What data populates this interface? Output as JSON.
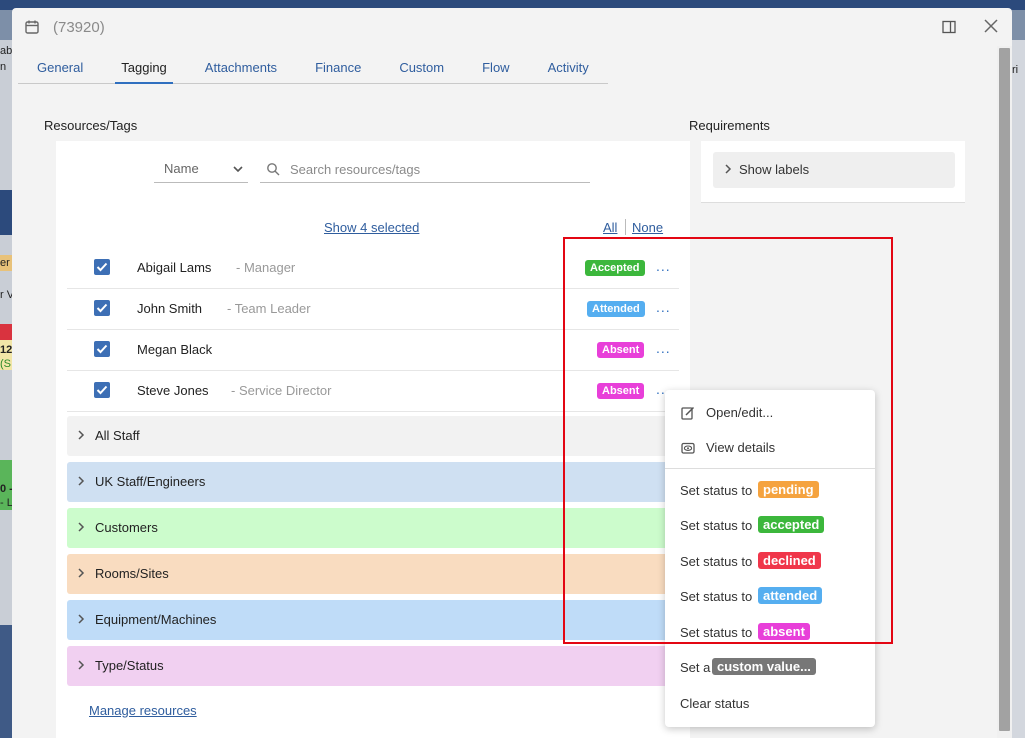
{
  "dialog": {
    "title": "(73920)"
  },
  "tabs": [
    {
      "label": "General"
    },
    {
      "label": "Tagging"
    },
    {
      "label": "Attachments"
    },
    {
      "label": "Finance"
    },
    {
      "label": "Custom"
    },
    {
      "label": "Flow"
    },
    {
      "label": "Activity"
    }
  ],
  "resources": {
    "section_label": "Resources/Tags",
    "sort_select": "Name",
    "search_placeholder": "Search resources/tags",
    "show_selected": "Show 4 selected",
    "all_label": "All",
    "none_label": "None",
    "rows": [
      {
        "name": "Abigail Lams",
        "role": "- Manager",
        "status": "Accepted",
        "status_color": "#3cb73c",
        "checked": true
      },
      {
        "name": "John Smith",
        "role": "- Team Leader",
        "status": "Attended",
        "status_color": "#55aef0",
        "checked": true
      },
      {
        "name": "Megan Black",
        "role": "",
        "status": "Absent",
        "status_color": "#e83fd9",
        "checked": true
      },
      {
        "name": "Steve Jones",
        "role": "- Service Director",
        "status": "Absent",
        "status_color": "#e83fd9",
        "checked": true
      }
    ],
    "more_label": "...",
    "groups": [
      {
        "name": "All Staff",
        "color": "#f2f2f2"
      },
      {
        "name": "UK Staff/Engineers",
        "color": "#cfe0f2"
      },
      {
        "name": "Customers",
        "color": "#ccfccc"
      },
      {
        "name": "Rooms/Sites",
        "color": "#f9dcc0"
      },
      {
        "name": "Equipment/Machines",
        "color": "#bfdcf8"
      },
      {
        "name": "Type/Status",
        "color": "#f1d0f1"
      }
    ],
    "manage_link": "Manage resources"
  },
  "requirements": {
    "section_label": "Requirements",
    "show_labels": "Show labels"
  },
  "context_menu": {
    "open_edit": "Open/edit...",
    "view_details": "View details",
    "set_status_prefix": "Set status to",
    "statuses": [
      {
        "label": "pending",
        "color": "#f5a33f"
      },
      {
        "label": "accepted",
        "color": "#3cb73c"
      },
      {
        "label": "declined",
        "color": "#f0364a"
      },
      {
        "label": "attended",
        "color": "#55aef0"
      },
      {
        "label": "absent",
        "color": "#e83fd9"
      }
    ],
    "set_a": "Set a",
    "custom_value": "custom value...",
    "custom_color": "#777777",
    "clear_status": "Clear status"
  },
  "background": {
    "left_snippets": [
      "abe",
      "n",
      "er",
      "r V",
      "12",
      "(S",
      "0 -",
      "- L"
    ],
    "right_snippet": "ri"
  }
}
